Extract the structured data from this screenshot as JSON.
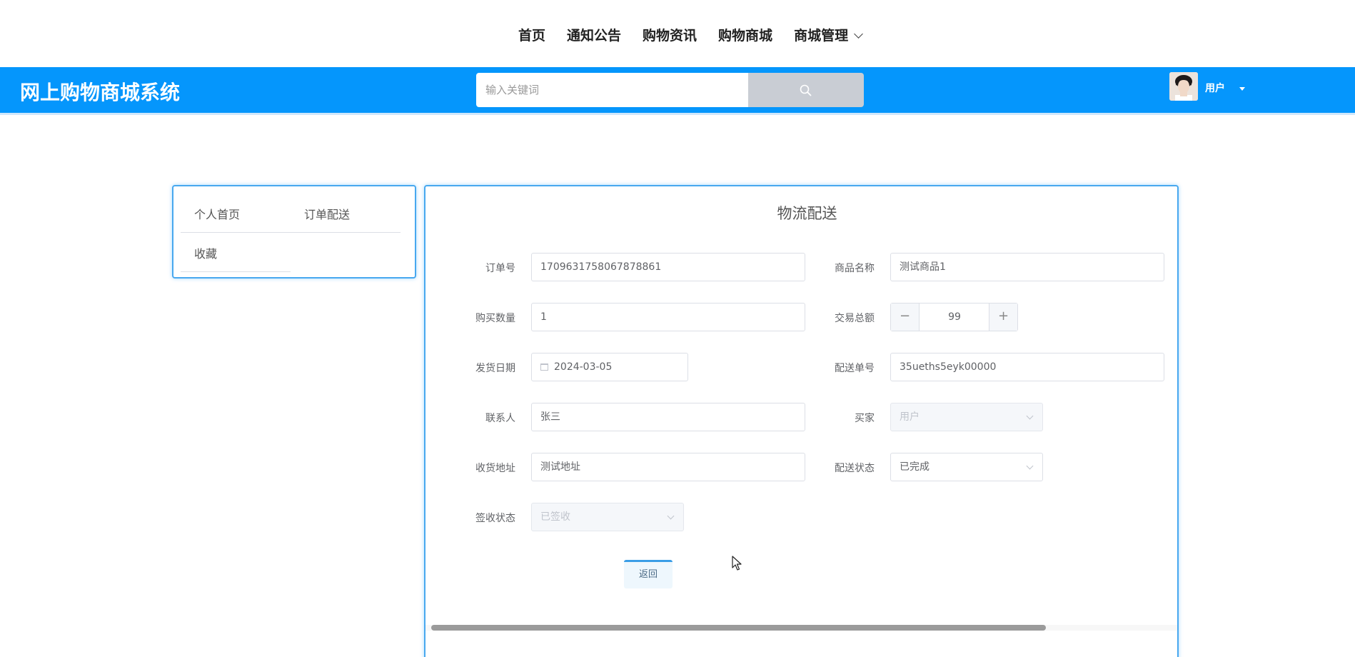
{
  "nav": {
    "items": [
      "首页",
      "通知公告",
      "购物资讯",
      "购物商城"
    ],
    "manage_label": "商城管理"
  },
  "header": {
    "site_title": "网上购物商城系统",
    "search_placeholder": "输入关键词",
    "search_icon": "search-icon",
    "user_name": "用户",
    "header_color": "#0596fc"
  },
  "sidebar": {
    "items": [
      "个人首页",
      "订单配送",
      "收藏"
    ]
  },
  "form": {
    "title": "物流配送",
    "order_no_label": "订单号",
    "order_no": "1709631758067878861",
    "product_name_label": "商品名称",
    "product_name": "测试商品1",
    "quantity_label": "购买数量",
    "quantity": "1",
    "total_label": "交易总额",
    "total": "99",
    "ship_date_label": "发货日期",
    "ship_date": "2024-03-05",
    "delivery_no_label": "配送单号",
    "delivery_no": "35ueths5eyk00000",
    "contact_label": "联系人",
    "contact": "张三",
    "buyer_label": "买家",
    "buyer": "用户",
    "address_label": "收货地址",
    "address": "测试地址",
    "delivery_status_label": "配送状态",
    "delivery_status": "已完成",
    "sign_status_label": "签收状态",
    "sign_status": "已签收",
    "back_label": "返回"
  }
}
